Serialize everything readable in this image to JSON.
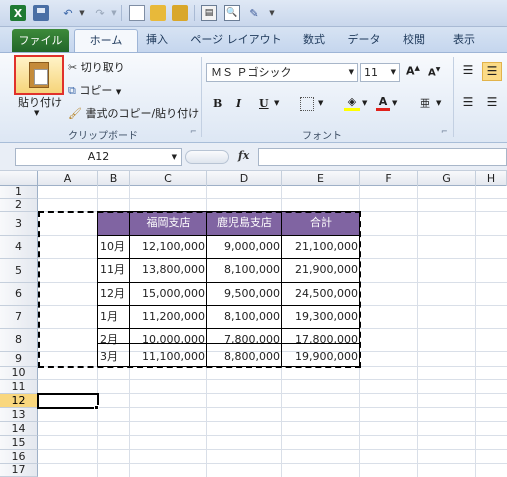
{
  "tabs": [
    "ファイル",
    "ホーム",
    "挿入",
    "ページ レイアウト",
    "数式",
    "データ",
    "校閲",
    "表示"
  ],
  "ribbon": {
    "paste_label": "貼り付け",
    "cut_label": "切り取り",
    "copy_label": "コピー",
    "format_painter_label": "書式のコピー/貼り付け",
    "clipboard_group": "クリップボード",
    "font_name": "ＭＳ Ｐゴシック",
    "font_size": "11",
    "font_group": "フォント",
    "bold": "B",
    "italic": "I",
    "underline": "U"
  },
  "formula": {
    "name_box": "A12",
    "fx": "fx",
    "value": ""
  },
  "columns": [
    "A",
    "B",
    "C",
    "D",
    "E",
    "F",
    "G",
    "H"
  ],
  "rows": [
    "1",
    "2",
    "3",
    "4",
    "5",
    "6",
    "7",
    "8",
    "9",
    "10",
    "11",
    "12",
    "13",
    "14",
    "15",
    "16",
    "17"
  ],
  "table": {
    "headers": [
      "",
      "福岡支店",
      "鹿児島支店",
      "合計"
    ],
    "rows": [
      [
        "10月",
        "12,100,000",
        "9,000,000",
        "21,100,000"
      ],
      [
        "11月",
        "13,800,000",
        "8,100,000",
        "21,900,000"
      ],
      [
        "12月",
        "15,000,000",
        "9,500,000",
        "24,500,000"
      ],
      [
        "1月",
        "11,200,000",
        "8,100,000",
        "19,300,000"
      ],
      [
        "2月",
        "10,000,000",
        "7,800,000",
        "17,800,000"
      ],
      [
        "3月",
        "11,100,000",
        "8,800,000",
        "19,900,000"
      ]
    ]
  },
  "colors": {
    "header_fill": "#8064a2",
    "selected_header": "#f9d77e",
    "file_tab": "#2e7d32"
  }
}
